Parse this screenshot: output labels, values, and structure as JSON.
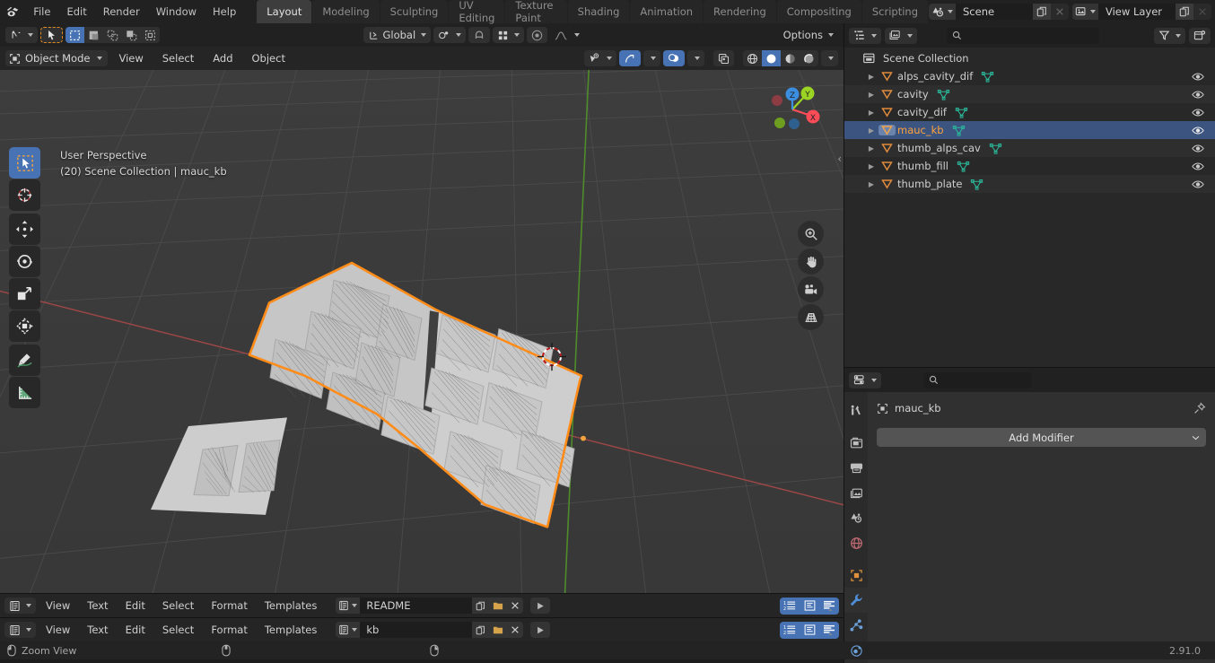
{
  "app": {
    "name": "Blender",
    "version": "2.91.0"
  },
  "topbar": {
    "logo_icon": "blender-logo-icon",
    "menus": [
      "File",
      "Edit",
      "Render",
      "Window",
      "Help"
    ],
    "workspace_tabs": [
      {
        "label": "Layout",
        "active": true
      },
      {
        "label": "Modeling",
        "active": false
      },
      {
        "label": "Sculpting",
        "active": false
      },
      {
        "label": "UV Editing",
        "active": false
      },
      {
        "label": "Texture Paint",
        "active": false
      },
      {
        "label": "Shading",
        "active": false
      },
      {
        "label": "Animation",
        "active": false
      },
      {
        "label": "Rendering",
        "active": false
      },
      {
        "label": "Compositing",
        "active": false
      },
      {
        "label": "Scripting",
        "active": false
      }
    ],
    "scene": {
      "icon": "scene-icon",
      "value": "Scene",
      "copy_icon": "duplicate-icon",
      "unlink_icon": "close-x-icon"
    },
    "view_layer": {
      "icon": "view-layer-icon",
      "value": "View Layer",
      "copy_icon": "duplicate-icon",
      "unlink_icon": "close-x-icon"
    }
  },
  "viewport_header": {
    "editor_type_icon": "editor-type-3dview-icon",
    "cursor_tool_icon": "select-box-cursor-icon",
    "select_modes": [
      "select-box-icon",
      "select-circle-icon",
      "select-lasso-icon",
      "select-extend-icon",
      "select-tweak-icon"
    ],
    "transform_orientation": {
      "icon": "orientation-icon",
      "value": "Global"
    },
    "pivot_icon": "pivot-point-icon",
    "snap_icon": "magnet-icon",
    "snap_target_icon": "snap-increment-icon",
    "proportional_icon": "proportional-edit-icon",
    "falloff_icon": "falloff-curve-icon",
    "options_label": "Options"
  },
  "viewport_header2": {
    "mode": {
      "icon": "object-mode-icon",
      "label": "Object Mode"
    },
    "menus": [
      "View",
      "Select",
      "Add",
      "Object"
    ],
    "visibility_icon": "show-hide-icon",
    "gizmo_icon": "gizmo-icon",
    "overlays_icon": "overlays-icon",
    "xray_icon": "xray-toggle-icon",
    "shading_modes": [
      "wireframe-icon",
      "solid-icon",
      "material-preview-icon",
      "rendered-icon"
    ],
    "shading_active_index": 1
  },
  "viewport": {
    "info_line1": "User Perspective",
    "info_line2": "(20) Scene Collection | mauc_kb",
    "toolbar_tools": [
      {
        "name": "tweak-select-tool",
        "active": true
      },
      {
        "name": "cursor-tool",
        "active": false
      },
      {
        "name": "move-tool",
        "active": false
      },
      {
        "name": "rotate-tool",
        "active": false
      },
      {
        "name": "scale-tool",
        "active": false
      },
      {
        "name": "transform-tool",
        "active": false
      },
      {
        "name": "annotate-tool",
        "active": false
      },
      {
        "name": "measure-tool",
        "active": false
      }
    ],
    "nav_buttons": [
      "zoom-icon",
      "pan-hand-icon",
      "camera-view-icon",
      "toggle-ortho-icon"
    ],
    "axis_gizmo": {
      "x_label": "X",
      "y_label": "Y",
      "z_label": "Z",
      "x_color": "#fc4c58",
      "y_color": "#9cd424",
      "z_color": "#3c8fe0"
    },
    "selection_outline_color": "#ff8c19",
    "grid_color": "#4a4a4a",
    "x_axis_color": "#b34747",
    "y_axis_color": "#5c9e2e"
  },
  "outliner": {
    "display_mode_icon": "outliner-display-mode-icon",
    "filter_id_icon": "filter-id-icon",
    "search_icon": "search-icon",
    "filter_icon": "filter-funnel-icon",
    "new_collection_icon": "new-collection-icon",
    "search_value": "",
    "root": {
      "icon": "collection-icon",
      "label": "Scene Collection"
    },
    "items": [
      {
        "label": "alps_cavity_dif",
        "selected": false,
        "icon": "object-mesh-icon",
        "data_icon": "mesh-data-icon"
      },
      {
        "label": "cavity",
        "selected": false,
        "icon": "object-mesh-icon",
        "data_icon": "mesh-data-icon"
      },
      {
        "label": "cavity_dif",
        "selected": false,
        "icon": "object-mesh-icon",
        "data_icon": "mesh-data-icon"
      },
      {
        "label": "mauc_kb",
        "selected": true,
        "icon": "object-mesh-icon",
        "data_icon": "mesh-data-icon"
      },
      {
        "label": "thumb_alps_cav",
        "selected": false,
        "icon": "object-mesh-icon",
        "data_icon": "mesh-data-icon"
      },
      {
        "label": "thumb_fill",
        "selected": false,
        "icon": "object-mesh-icon",
        "data_icon": "mesh-data-icon"
      },
      {
        "label": "thumb_plate",
        "selected": false,
        "icon": "object-mesh-icon",
        "data_icon": "mesh-data-icon"
      }
    ],
    "visibility_icon": "eye-icon"
  },
  "properties": {
    "editor_type_icon": "editor-type-properties-icon",
    "search_icon": "search-icon",
    "search_value": "",
    "tabs": [
      {
        "name": "tool-tab",
        "icon": "tool-icon",
        "active": false
      },
      {
        "name": "render-tab",
        "icon": "render-camera-icon",
        "active": false
      },
      {
        "name": "output-tab",
        "icon": "printer-icon",
        "active": false
      },
      {
        "name": "view-layer-tab",
        "icon": "images-icon",
        "active": false
      },
      {
        "name": "scene-tab",
        "icon": "scene-cone-icon",
        "active": false
      },
      {
        "name": "world-tab",
        "icon": "world-globe-icon",
        "active": false
      },
      {
        "name": "object-tab",
        "icon": "object-square-icon",
        "active": false
      },
      {
        "name": "modifier-tab",
        "icon": "wrench-icon",
        "active": true
      },
      {
        "name": "particles-tab",
        "icon": "particles-icon",
        "active": false
      },
      {
        "name": "physics-tab",
        "icon": "physics-orbit-icon",
        "active": false
      }
    ],
    "breadcrumb": {
      "icon": "object-square-icon",
      "label": "mauc_kb"
    },
    "pin_icon": "pin-icon",
    "add_modifier_label": "Add Modifier"
  },
  "text_editors": [
    {
      "editor_type_icon": "editor-type-text-icon",
      "menus": [
        "View",
        "Text",
        "Edit",
        "Select",
        "Format",
        "Templates"
      ],
      "datablock_icon": "text-datablock-icon",
      "filename": "README",
      "new_icon": "new-text-icon",
      "open_icon": "open-folder-icon",
      "unlink_icon": "close-x-icon",
      "run_icon": "run-script-icon",
      "toggles": [
        "line-numbers-icon",
        "word-wrap-icon",
        "syntax-highlight-icon"
      ]
    },
    {
      "editor_type_icon": "editor-type-text-icon",
      "menus": [
        "View",
        "Text",
        "Edit",
        "Select",
        "Format",
        "Templates"
      ],
      "datablock_icon": "text-datablock-icon",
      "filename": "kb",
      "new_icon": "new-text-icon",
      "open_icon": "open-folder-icon",
      "unlink_icon": "close-x-icon",
      "run_icon": "run-script-icon",
      "toggles": [
        "line-numbers-icon",
        "word-wrap-icon",
        "syntax-highlight-icon"
      ]
    }
  ],
  "statusbar": {
    "mouse_left_icon": "mouse-left-button-icon",
    "keymap_label": "Zoom View",
    "mouse_middle_icon": "mouse-middle-button-icon",
    "mouse_right_icon": "mouse-right-button-icon",
    "version": "2.91.0"
  }
}
